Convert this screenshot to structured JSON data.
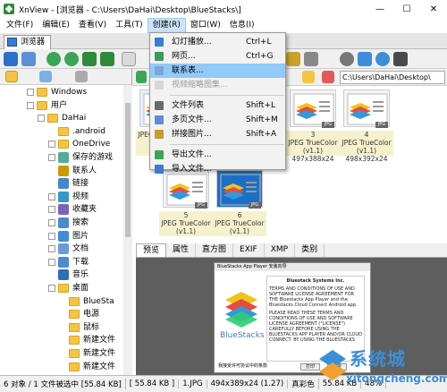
{
  "window": {
    "title": "XnView - [浏览器 - C:\\Users\\DaHai\\Desktop\\BlueStacks\\]",
    "minimize": "—",
    "maximize": "☐",
    "close": "✕"
  },
  "menu": [
    "文件(F)",
    "编辑(E)",
    "查看(V)",
    "工具(T)",
    "创建(R)",
    "窗口(W)",
    "信息(I)"
  ],
  "tab": {
    "label": "浏览器"
  },
  "tree": [
    {
      "label": "Windows",
      "indent": 0,
      "type": "folder",
      "exp": "+"
    },
    {
      "label": "用户",
      "indent": 0,
      "type": "folder",
      "exp": "−"
    },
    {
      "label": "DaHai",
      "indent": 1,
      "type": "folder",
      "exp": "−"
    },
    {
      "label": ".android",
      "indent": 2,
      "type": "folder",
      "exp": ""
    },
    {
      "label": "OneDrive",
      "indent": 2,
      "type": "folder",
      "exp": "+"
    },
    {
      "label": "保存的游戏",
      "indent": 2,
      "type": "special",
      "exp": "+"
    },
    {
      "label": "联系人",
      "indent": 2,
      "type": "special",
      "exp": ""
    },
    {
      "label": "链接",
      "indent": 2,
      "type": "special",
      "exp": ""
    },
    {
      "label": "视频",
      "indent": 2,
      "type": "special",
      "exp": "+"
    },
    {
      "label": "收藏夹",
      "indent": 2,
      "type": "special",
      "exp": "+"
    },
    {
      "label": "搜索",
      "indent": 2,
      "type": "special",
      "exp": "+"
    },
    {
      "label": "图片",
      "indent": 2,
      "type": "special",
      "exp": "+"
    },
    {
      "label": "文档",
      "indent": 2,
      "type": "special",
      "exp": "+"
    },
    {
      "label": "下载",
      "indent": 2,
      "type": "special",
      "exp": "+"
    },
    {
      "label": "音乐",
      "indent": 2,
      "type": "special",
      "exp": ""
    },
    {
      "label": "桌面",
      "indent": 2,
      "type": "folder",
      "exp": "−"
    },
    {
      "label": "BlueSta",
      "indent": 3,
      "type": "folder",
      "exp": ""
    },
    {
      "label": "电源",
      "indent": 3,
      "type": "folder",
      "exp": ""
    },
    {
      "label": "鼠标",
      "indent": 3,
      "type": "folder",
      "exp": ""
    },
    {
      "label": "新建文件",
      "indent": 3,
      "type": "folder",
      "exp": ""
    },
    {
      "label": "新建文件",
      "indent": 3,
      "type": "folder",
      "exp": ""
    },
    {
      "label": "新建文件",
      "indent": 3,
      "type": "folder",
      "exp": ""
    }
  ],
  "address": "C:\\Users\\DaHai\\Desktop\\",
  "thumbnails": [
    {
      "num": "",
      "line1": "JPEG TrueColor (v1.1)",
      "line2": "",
      "badge": "JPG"
    },
    {
      "num": "",
      "line1": "JPEG TrueColor (v1.1)",
      "line2": "",
      "badge": "JPG"
    },
    {
      "num": "3",
      "line1": "JPEG TrueColor (v1.1)",
      "line2": "497x388x24",
      "badge": "JPG"
    },
    {
      "num": "4",
      "line1": "JPEG TrueColor (v1.1)",
      "line2": "498x392x24",
      "badge": "JPG"
    },
    {
      "num": "5",
      "line1": "JPEG TrueColor (v1.1)",
      "line2": "",
      "badge": "JPG"
    },
    {
      "num": "6",
      "line1": "JPEG TrueColor (v1.1)",
      "line2": "",
      "badge": "JPG"
    }
  ],
  "preview_tabs": [
    "预览",
    "属性",
    "直方图",
    "EXIF",
    "XMP",
    "类别"
  ],
  "dialog": {
    "title": "BlueStacks App Player 安装向导",
    "brand": "BlueStacks",
    "license_heading": "Bluestack Systems Inc.",
    "license_p1": "TERMS AND CONDITIONS OF USE AND SOFTWARE LICENSE AGREEMENT FOR THE Bluestacks App Player and the Bluestacks Cloud Connect Android app.",
    "license_p2": "PLEASE READ THESE TERMS AND CONDITIONS OF USE AND SOFTWARE LICENSE AGREEMENT (\"LICENSE\") CAREFULLY BEFORE USING THE BLUESTACKS APP PLAYER AND/OR CLOUD CONNECT. BY USING THE BLUESTACKS",
    "agree": "我接受许可协议中的条款",
    "btn_print": "打印",
    "btn_accept": "接受"
  },
  "create_menu": [
    {
      "label": "幻灯播放...",
      "shortcut": "Ctrl+L",
      "disabled": false,
      "highlight": false,
      "icon": "slideshow-icon"
    },
    {
      "label": "网页...",
      "shortcut": "Ctrl+G",
      "disabled": false,
      "highlight": false,
      "icon": "webpage-icon"
    },
    {
      "label": "联系表...",
      "shortcut": "",
      "disabled": false,
      "highlight": true,
      "icon": "contact-sheet-icon"
    },
    {
      "label": "视频缩略图集...",
      "shortcut": "",
      "disabled": true,
      "highlight": false,
      "icon": "video-thumbnail-icon"
    },
    {
      "label": "文件列表",
      "shortcut": "Shift+L",
      "disabled": false,
      "highlight": false,
      "icon": "file-list-icon"
    },
    {
      "label": "多页文件...",
      "shortcut": "Shift+M",
      "disabled": false,
      "highlight": false,
      "icon": "multipage-icon"
    },
    {
      "label": "拼接图片...",
      "shortcut": "Shift+A",
      "disabled": false,
      "highlight": false,
      "icon": "strip-icon"
    },
    {
      "label": "导出文件...",
      "shortcut": "",
      "disabled": false,
      "highlight": false,
      "icon": "export-icon"
    },
    {
      "label": "导入文件...",
      "shortcut": "",
      "disabled": false,
      "highlight": false,
      "icon": "import-icon"
    }
  ],
  "status": [
    "6 对象 / 1 文件被选中 [55.84 KB]",
    "[ 55.84 KB ]",
    "1.JPG",
    "494x389x24 (1.27)",
    "真彩色",
    "55.84 KB",
    "48%"
  ],
  "watermark": {
    "text": "系统城",
    "url": "xitongcheng.com"
  },
  "colors": {
    "accent": "#3c8ed8",
    "highlight": "#91c9f7",
    "caption_bg": "#f6f1cc",
    "folder": "#f4c542"
  }
}
